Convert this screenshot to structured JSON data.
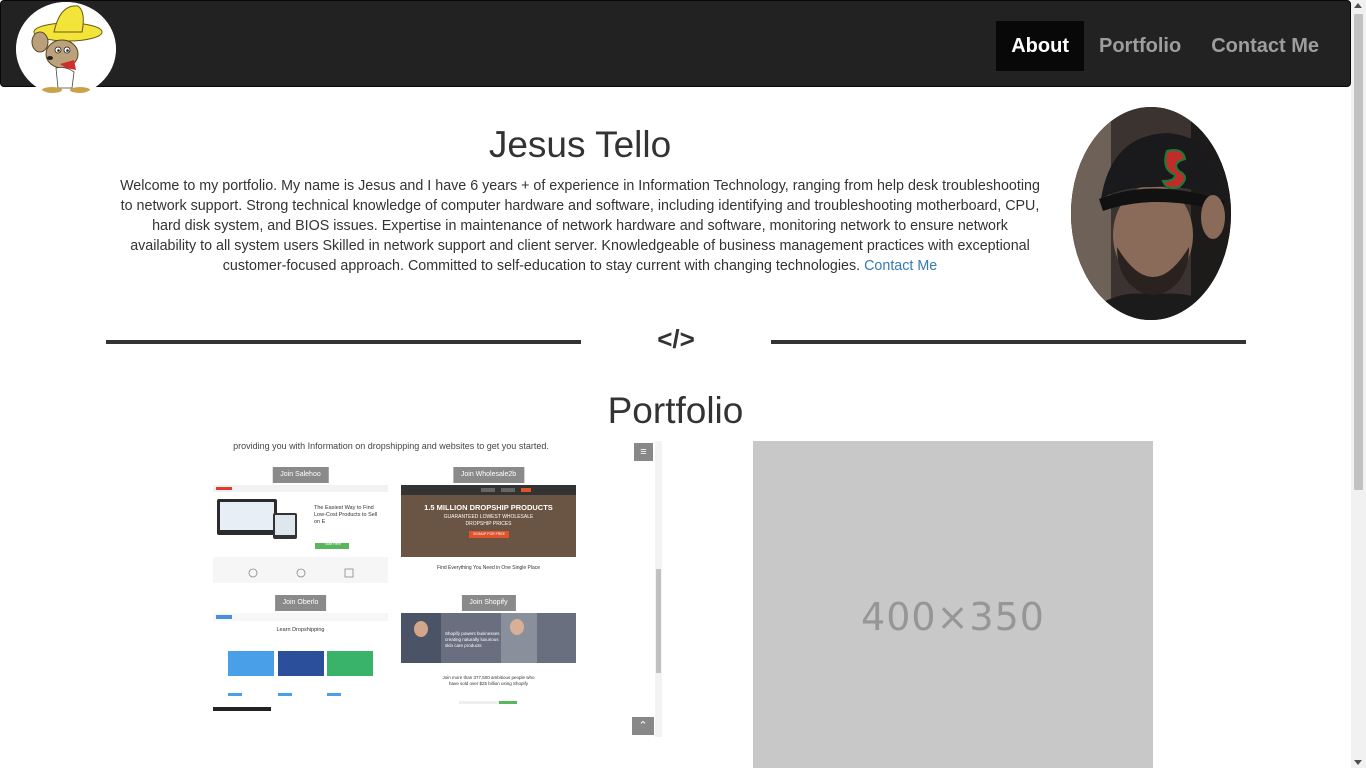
{
  "nav": {
    "links": [
      "About",
      "Portfolio",
      "Contact Me"
    ],
    "active": "About"
  },
  "about": {
    "name": "Jesus Tello",
    "bio": "Welcome to my portfolio. My name is Jesus and I have 6 years + of experience in Information Technology, ranging from help desk troubleshooting to network support. Strong technical knowledge of computer hardware and software, including identifying and troubleshooting motherboard, CPU, hard disk system, and BIOS issues. Expertise in maintenance of network hardware and software, monitoring network to ensure network availability to all system users Skilled in network support and client server. Knowledgeable of business management practices with exceptional customer-focused approach. Committed to self-education to stay current with changing technologies.",
    "contact_link": "Contact Me"
  },
  "divider": {
    "symbol": "</>"
  },
  "portfolio": {
    "title": "Portfolio",
    "preview": {
      "intro": "providing you with Information on dropshipping and websites to get you started.",
      "cards": [
        {
          "button": "Join Salehoo",
          "headline": "The Easiest Way to Find Low-Cost Products to Sell on E",
          "cta": "Start Here"
        },
        {
          "button": "Join Wholesale2b",
          "headline": "1.5 MILLION DROPSHIP PRODUCTS",
          "sub": "GUARANTEED LOWEST WHOLESALE DROPSHIP PRICES",
          "cta": "SIGNUP FOR FREE",
          "footer": "Find Everything You Need in One Single Place"
        },
        {
          "button": "Join Oberlo",
          "headline": "Learn Dropshipping"
        },
        {
          "button": "Join Shopify",
          "headline": "Shopify powers businesses creating naturally luxurious skin care products",
          "footer": "Join more than 377,500 ambitious people who have sold over $25 billion using Shopify"
        }
      ]
    },
    "placeholder": "400×350"
  },
  "colors": {
    "navbar": "#222222",
    "nav_active": "#080808",
    "link": "#337ab7",
    "placeholder_bg": "#c8c8c8"
  },
  "icons": [
    "speedy-gonzales-logo",
    "menu-icon",
    "chevron-up-icon"
  ]
}
